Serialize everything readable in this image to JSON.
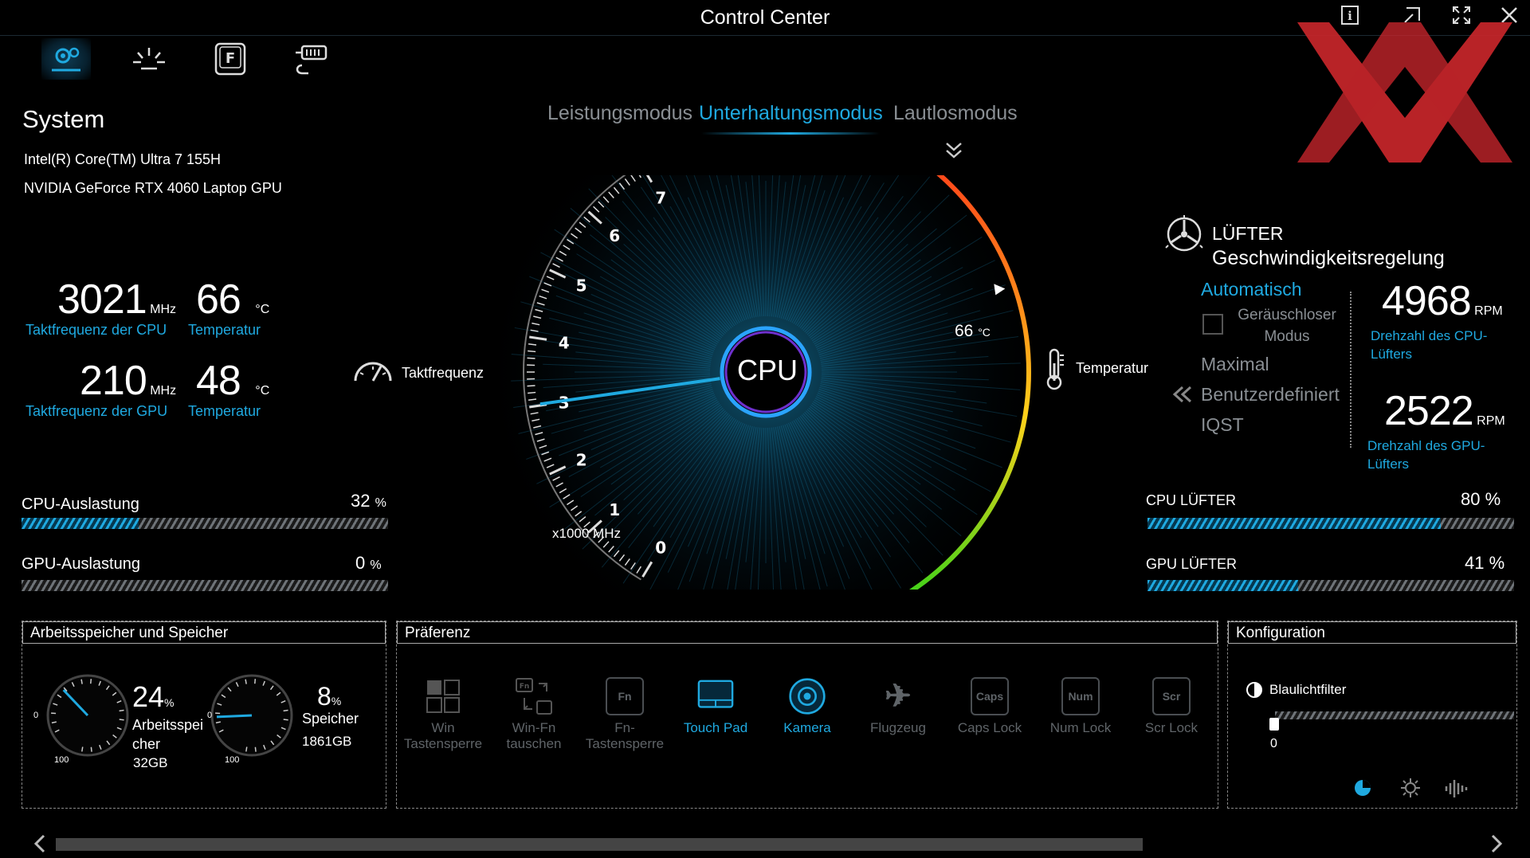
{
  "window": {
    "title": "Control Center"
  },
  "system": {
    "title": "System",
    "cpu_name": "Intel(R) Core(TM) Ultra 7 155H",
    "gpu_name": "NVIDIA GeForce RTX 4060 Laptop GPU",
    "cpu_clock": {
      "value": "3021",
      "unit": "MHz",
      "label": "Taktfrequenz der CPU"
    },
    "cpu_temp": {
      "value": "66",
      "unit": "°C",
      "label": "Temperatur"
    },
    "gpu_clock": {
      "value": "210",
      "unit": "MHz",
      "label": "Taktfrequenz der GPU"
    },
    "gpu_temp": {
      "value": "48",
      "unit": "°C",
      "label": "Temperatur"
    },
    "cpu_load": {
      "label": "CPU-Auslastung",
      "value": "32",
      "unit": "%",
      "percent": 32
    },
    "gpu_load": {
      "label": "GPU-Auslastung",
      "value": "0",
      "unit": "%",
      "percent": 0
    }
  },
  "modes": {
    "items": [
      "Leistungsmodus",
      "Unterhaltungsmodus",
      "Lautlosmodus"
    ],
    "active": 1
  },
  "gauge": {
    "center_label": "CPU",
    "left_label": "Taktfrequenz",
    "right_label": "Temperatur",
    "scale_ticks": [
      "7",
      "6",
      "5",
      "4",
      "3",
      "2",
      "1",
      "0"
    ],
    "scale_unit": "x1000 MHz",
    "temp_value": "66",
    "temp_unit": "°C",
    "clock_value_mhz": 3021,
    "temp_value_c": 66
  },
  "fan": {
    "title1": "LÜFTER",
    "title2": "Geschwindigkeitsregelung",
    "auto": "Automatisch",
    "quiet": "Geräuschloser Modus",
    "max": "Maximal",
    "custom": "Benutzerdefiniert",
    "iqst": "IQST",
    "cpu_rpm": "4968",
    "cpu_rpm_unit": "RPM",
    "cpu_rpm_label": "Drehzahl des CPU-Lüfters",
    "gpu_rpm": "2522",
    "gpu_rpm_unit": "RPM",
    "gpu_rpm_label": "Drehzahl des GPU-Lüfters",
    "cpu_fan": {
      "label": "CPU LÜFTER",
      "value": "80",
      "unit": "%",
      "percent": 80
    },
    "gpu_fan": {
      "label": "GPU LÜFTER",
      "value": "41",
      "unit": "%",
      "percent": 41
    }
  },
  "memory": {
    "title": "Arbeitsspeicher und Speicher",
    "ram": {
      "value": "24",
      "unit": "%",
      "label": "Arbeitsspeicher",
      "size": "32GB",
      "percent": 24,
      "min": "0",
      "max": "100"
    },
    "storage": {
      "value": "8",
      "unit": "%",
      "label": "Speicher",
      "size": "1861GB",
      "percent": 8,
      "min": "0",
      "max": "100"
    }
  },
  "preference": {
    "title": "Präferenz",
    "items": [
      {
        "label": "Win Tastensperre",
        "glyph": "",
        "on": false
      },
      {
        "label": "Win-Fn tauschen",
        "glyph": "Fn",
        "on": false
      },
      {
        "label": "Fn-Tastensperre",
        "glyph": "Fn",
        "on": false
      },
      {
        "label": "Touch Pad",
        "glyph": "",
        "on": true
      },
      {
        "label": "Kamera",
        "glyph": "",
        "on": true
      },
      {
        "label": "Flugzeug",
        "glyph": "✈",
        "on": false
      },
      {
        "label": "Caps Lock",
        "glyph": "Caps",
        "on": false
      },
      {
        "label": "Num Lock",
        "glyph": "Num",
        "on": false
      },
      {
        "label": "Scr Lock",
        "glyph": "Scr",
        "on": false
      }
    ]
  },
  "config": {
    "title": "Konfiguration",
    "bluelight": "Blaulichtfilter",
    "bluelight_value": "0"
  },
  "colors": {
    "accent": "#1fa9e0",
    "watermark": "#c8262b"
  }
}
